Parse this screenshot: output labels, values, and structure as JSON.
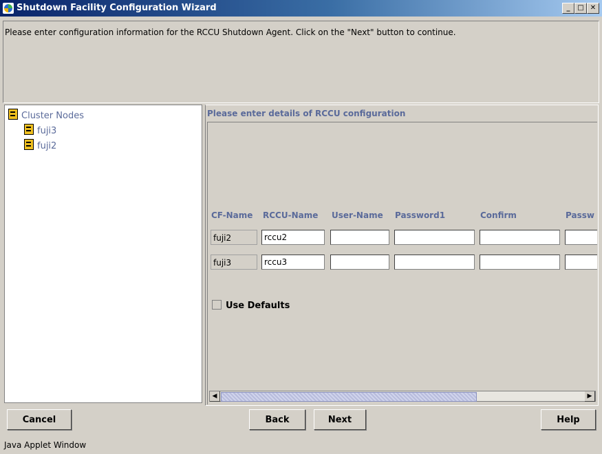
{
  "window": {
    "title": "Shutdown Facility Configuration Wizard",
    "controls": {
      "minimize": "_",
      "maximize": "□",
      "close": "✕"
    }
  },
  "instruction": "Please enter configuration information for the RCCU Shutdown Agent. Click on the \"Next\" button to continue.",
  "tree": {
    "root": {
      "label": "Cluster Nodes",
      "icon": "cluster-icon"
    },
    "children": [
      {
        "label": "fuji3",
        "icon": "node-icon"
      },
      {
        "label": "fuji2",
        "icon": "node-icon"
      }
    ]
  },
  "config": {
    "heading": "Please enter details of RCCU configuration",
    "columns": [
      "CF-Name",
      "RCCU-Name",
      "User-Name",
      "Password1",
      "Confirm",
      "Passw"
    ],
    "rows": [
      {
        "cf_name": "fuji2",
        "rccu_name": "rccu2",
        "user_name": "",
        "password1": "",
        "confirm": "",
        "password2": ""
      },
      {
        "cf_name": "fuji3",
        "rccu_name": "rccu3",
        "user_name": "",
        "password1": "",
        "confirm": "",
        "password2": ""
      }
    ],
    "use_defaults_label": "Use Defaults",
    "use_defaults_checked": false
  },
  "buttons": {
    "cancel": "Cancel",
    "back": "Back",
    "next": "Next",
    "help": "Help"
  },
  "status": "Java Applet Window",
  "colors": {
    "label_blue": "#5a6a9a",
    "background": "#d4d0c8",
    "titlebar": "#0a246a"
  }
}
